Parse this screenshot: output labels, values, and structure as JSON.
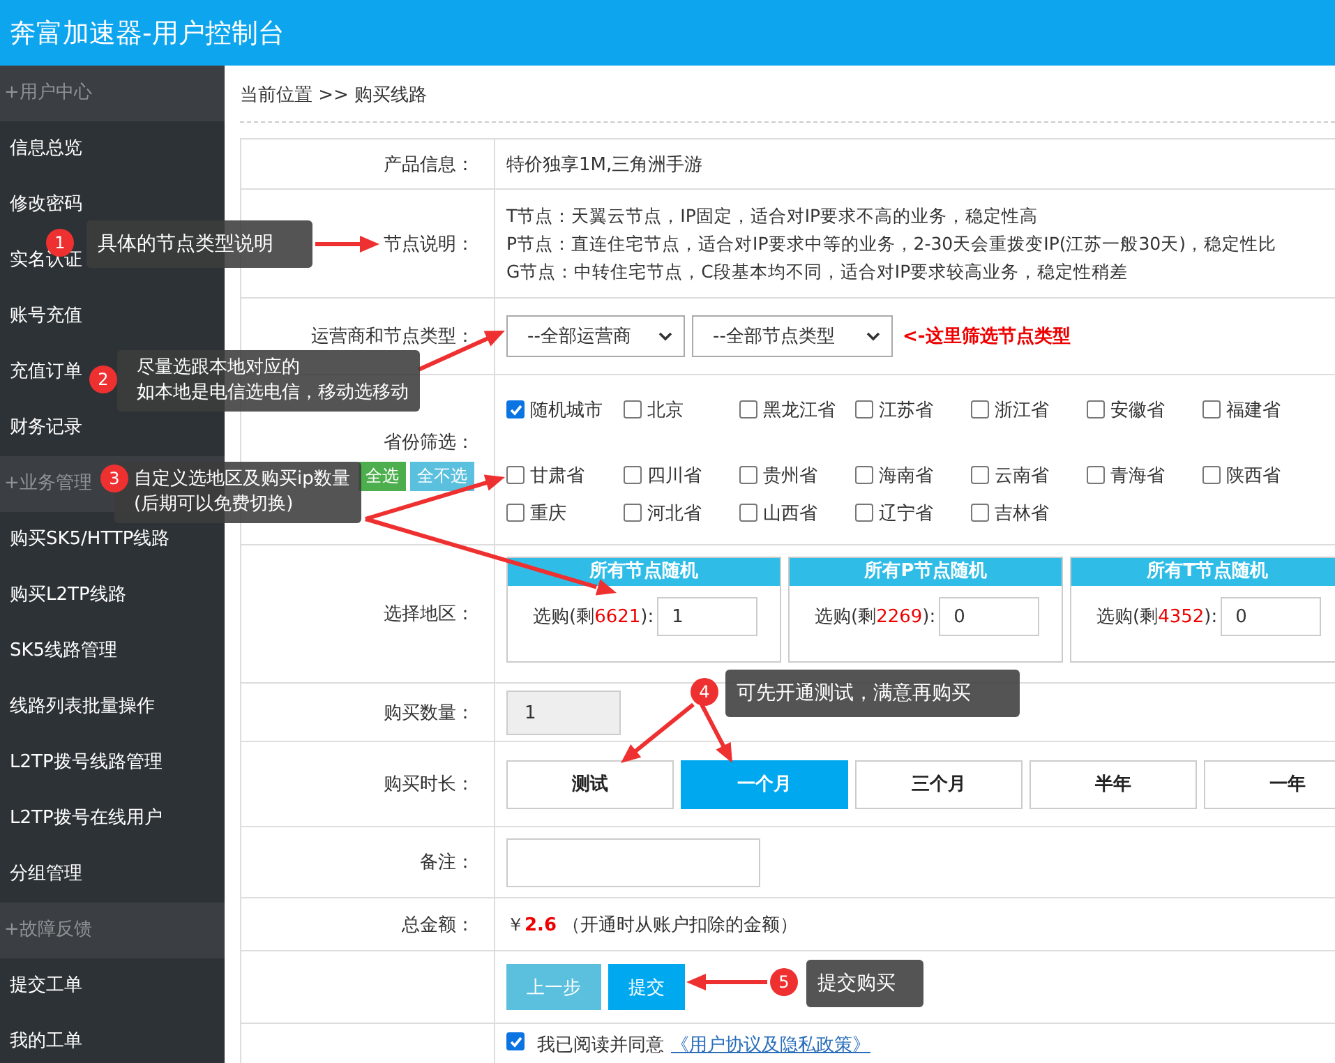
{
  "header": {
    "title": "奔富加速器-用户控制台"
  },
  "sidebar": [
    {
      "title": "+用户中心",
      "items": [
        "信息总览",
        "修改密码",
        "实名认证",
        "账号充值",
        "充值订单",
        "财务记录"
      ]
    },
    {
      "title": "+业务管理",
      "items": [
        "购买SK5/HTTP线路",
        "购买L2TP线路",
        "SK5线路管理",
        "线路列表批量操作",
        "L2TP拨号线路管理",
        "L2TP拨号在线用户",
        "分组管理"
      ]
    },
    {
      "title": "+故障反馈",
      "items": [
        "提交工单",
        "我的工单"
      ]
    }
  ],
  "breadcrumb": "当前位置 >> 购买线路",
  "form": {
    "product": {
      "label": "产品信息：",
      "value": "特价独享1M,三角洲手游"
    },
    "node_desc": {
      "label": "节点说明：",
      "lines": [
        "T节点：天翼云节点，IP固定，适合对IP要求不高的业务，稳定性高",
        "P节点：直连住宅节点，适合对IP要求中等的业务，2-30天会重拨变IP(江苏一般30天)，稳定性比",
        "G节点：中转住宅节点，C段基本均不同，适合对IP要求较高业务，稳定性稍差"
      ]
    },
    "filter": {
      "label": "运营商和节点类型：",
      "selects": [
        "--全部运营商",
        "--全部节点类型"
      ],
      "hint": "<-这里筛选节点类型"
    },
    "provinces": {
      "label": "省份筛选：",
      "select_all": "全选",
      "select_none": "全不选",
      "rows": [
        [
          {
            "name": "随机城市",
            "checked": true
          },
          {
            "name": "北京",
            "checked": false
          },
          {
            "name": "黑龙江省",
            "checked": false
          },
          {
            "name": "江苏省",
            "checked": false
          },
          {
            "name": "浙江省",
            "checked": false
          },
          {
            "name": "安徽省",
            "checked": false
          },
          {
            "name": "福建省",
            "checked": false
          }
        ],
        [
          {
            "name": "甘肃省",
            "checked": false
          },
          {
            "name": "四川省",
            "checked": false
          },
          {
            "name": "贵州省",
            "checked": false
          },
          {
            "name": "海南省",
            "checked": false
          },
          {
            "name": "云南省",
            "checked": false
          },
          {
            "name": "青海省",
            "checked": false
          },
          {
            "name": "陕西省",
            "checked": false
          }
        ],
        [
          {
            "name": "重庆",
            "checked": false
          },
          {
            "name": "河北省",
            "checked": false
          },
          {
            "name": "山西省",
            "checked": false
          },
          {
            "name": "辽宁省",
            "checked": false
          },
          {
            "name": "吉林省",
            "checked": false
          }
        ]
      ]
    },
    "region": {
      "label": "选择地区：",
      "cards": [
        {
          "title": "所有节点随机",
          "prefix": "选购(剩",
          "remaining": "6621",
          "suffix": "):",
          "value": "1"
        },
        {
          "title": "所有P节点随机",
          "prefix": "选购(剩",
          "remaining": "2269",
          "suffix": "):",
          "value": "0"
        },
        {
          "title": "所有T节点随机",
          "prefix": "选购(剩",
          "remaining": "4352",
          "suffix": "):",
          "value": "0"
        }
      ]
    },
    "quantity": {
      "label": "购买数量：",
      "value": "1"
    },
    "duration": {
      "label": "购买时长：",
      "options": [
        {
          "label": "测试",
          "selected": false
        },
        {
          "label": "一个月",
          "selected": true
        },
        {
          "label": "三个月",
          "selected": false
        },
        {
          "label": "半年",
          "selected": false
        },
        {
          "label": "一年",
          "selected": false
        }
      ]
    },
    "remark": {
      "label": "备注："
    },
    "total": {
      "label": "总金额：",
      "currency": "￥",
      "amount": "2.6",
      "note": "（开通时从账户扣除的金额）"
    },
    "buttons": {
      "back": "上一步",
      "submit": "提交"
    },
    "agreement": {
      "checked": true,
      "text": "我已阅读并同意",
      "link": "《用户协议及隐私政策》"
    }
  },
  "annotations": [
    {
      "number": "1",
      "lines": [
        "具体的节点类型说明"
      ]
    },
    {
      "number": "2",
      "lines": [
        "尽量选跟本地对应的",
        "如本地是电信选电信，移动选移动"
      ]
    },
    {
      "number": "3",
      "lines": [
        "自定义选地区及购买ip数量",
        "(后期可以免费切换)"
      ]
    },
    {
      "number": "4",
      "lines": [
        "可先开通测试，满意再购买"
      ]
    },
    {
      "number": "5",
      "lines": [
        "提交购买"
      ]
    }
  ]
}
